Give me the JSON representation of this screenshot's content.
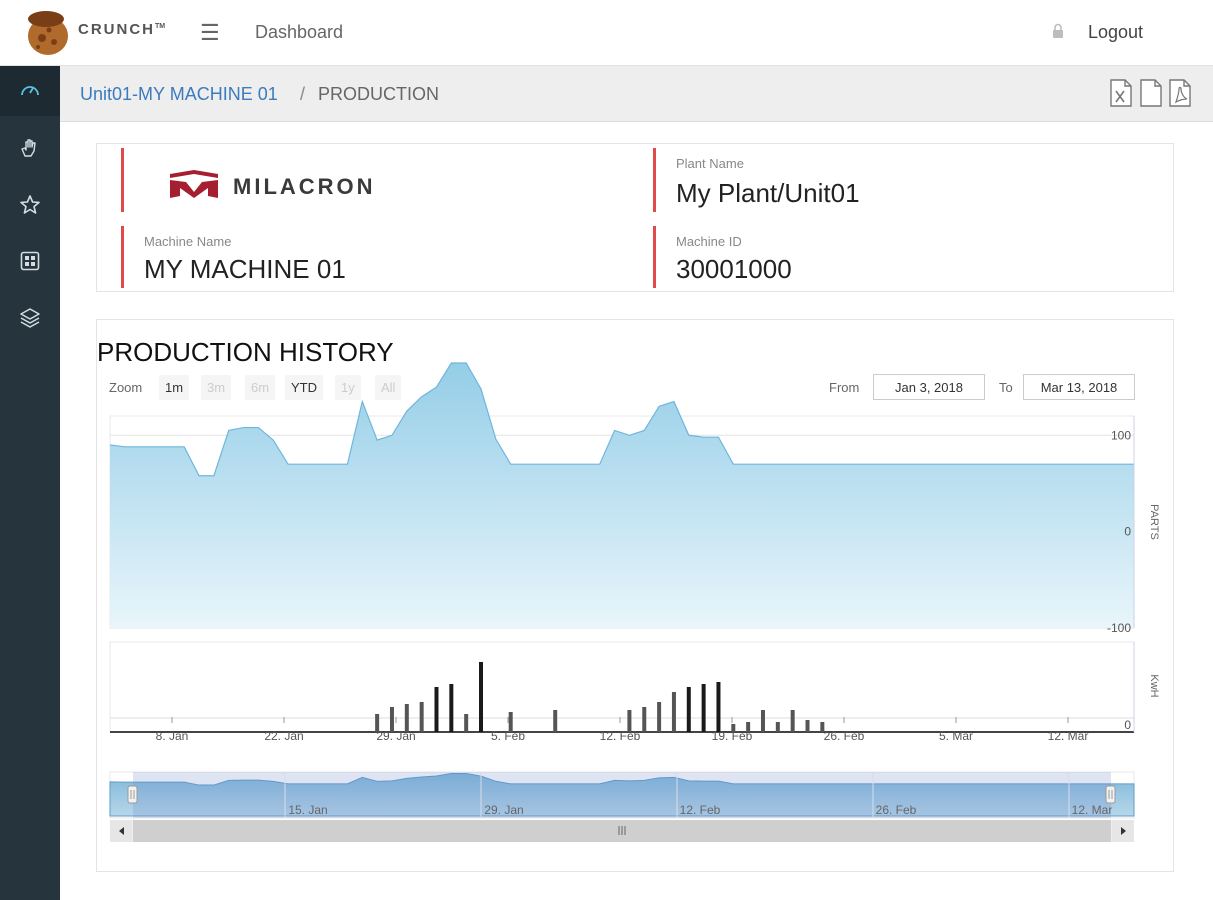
{
  "brand": {
    "name": "CRUNCH",
    "tm": "TM"
  },
  "topnav": {
    "menu_icon": "hamburger-icon",
    "dashboard_label": "Dashboard",
    "logout_label": "Logout",
    "lock_icon": "lock-icon"
  },
  "sidebar": {
    "items": [
      {
        "icon": "gauge-icon",
        "active": true
      },
      {
        "icon": "hand-icon"
      },
      {
        "icon": "star-icon"
      },
      {
        "icon": "grid-icon"
      },
      {
        "icon": "layers-icon"
      }
    ]
  },
  "breadcrumb": {
    "link": "Unit01-MY MACHINE 01",
    "separator": "/",
    "current": "PRODUCTION"
  },
  "export": {
    "buttons": [
      "excel-export-icon",
      "document-export-icon",
      "pdf-export-icon"
    ]
  },
  "colors": {
    "accent": "#e04a4a",
    "link": "#3b7bbf",
    "sidebar": "#25343d",
    "series_fill": "#8fcbe6",
    "logo_red": "#a51f30"
  },
  "machine_info": {
    "logo_text": "MILACRON",
    "plant_name_label": "Plant Name",
    "plant_name": "My Plant/Unit01",
    "machine_name_label": "Machine Name",
    "machine_name": "MY MACHINE 01",
    "machine_id_label": "Machine ID",
    "machine_id": "30001000"
  },
  "production_history": {
    "title": "PRODUCTION HISTORY",
    "zoom_label": "Zoom",
    "zoom_buttons": [
      {
        "label": "1m",
        "enabled": true
      },
      {
        "label": "3m",
        "enabled": false
      },
      {
        "label": "6m",
        "enabled": false
      },
      {
        "label": "YTD",
        "enabled": true
      },
      {
        "label": "1y",
        "enabled": false
      },
      {
        "label": "All",
        "enabled": false
      }
    ],
    "from_label": "From",
    "from_value": "Jan 3, 2018",
    "to_label": "To",
    "to_value": "Mar 13, 2018"
  },
  "chart_data": [
    {
      "type": "area",
      "ylabel": "PARTS",
      "ylim": [
        -100,
        120
      ],
      "yticks": [
        100,
        0,
        -100
      ],
      "grid": true,
      "x_range": [
        "2018-01-03",
        "2018-03-13"
      ],
      "series": [
        {
          "values": [
            [
              0,
              90
            ],
            [
              1,
              88
            ],
            [
              2,
              88
            ],
            [
              3,
              88
            ],
            [
              4,
              88
            ],
            [
              5,
              88
            ],
            [
              6,
              58
            ],
            [
              7,
              58
            ],
            [
              8,
              105
            ],
            [
              9,
              108
            ],
            [
              10,
              108
            ],
            [
              11,
              95
            ],
            [
              12,
              70
            ],
            [
              13,
              70
            ],
            [
              14,
              70
            ],
            [
              15,
              70
            ],
            [
              16,
              70
            ],
            [
              17,
              135
            ],
            [
              18,
              95
            ],
            [
              19,
              100
            ],
            [
              20,
              125
            ],
            [
              21,
              140
            ],
            [
              22,
              150
            ],
            [
              23,
              175
            ],
            [
              24,
              175
            ],
            [
              25,
              148
            ],
            [
              26,
              96
            ],
            [
              27,
              70
            ],
            [
              28,
              70
            ],
            [
              29,
              70
            ],
            [
              30,
              70
            ],
            [
              31,
              70
            ],
            [
              32,
              70
            ],
            [
              33,
              70
            ],
            [
              34,
              105
            ],
            [
              35,
              100
            ],
            [
              36,
              105
            ],
            [
              37,
              130
            ],
            [
              38,
              135
            ],
            [
              39,
              100
            ],
            [
              40,
              98
            ],
            [
              41,
              98
            ],
            [
              42,
              70
            ],
            [
              43,
              70
            ],
            [
              44,
              70
            ],
            [
              45,
              70
            ],
            [
              46,
              70
            ],
            [
              47,
              70
            ],
            [
              48,
              70
            ],
            [
              49,
              70
            ],
            [
              50,
              70
            ],
            [
              51,
              70
            ],
            [
              52,
              70
            ],
            [
              53,
              70
            ],
            [
              54,
              70
            ],
            [
              55,
              70
            ],
            [
              56,
              70
            ],
            [
              57,
              70
            ],
            [
              58,
              70
            ],
            [
              59,
              70
            ],
            [
              60,
              70
            ],
            [
              61,
              70
            ],
            [
              62,
              70
            ],
            [
              63,
              70
            ],
            [
              64,
              70
            ],
            [
              65,
              70
            ],
            [
              66,
              70
            ],
            [
              67,
              70
            ],
            [
              68,
              70
            ],
            [
              69,
              70
            ]
          ]
        }
      ]
    },
    {
      "type": "bar",
      "ylabel": "KwH",
      "yticks": [
        0
      ],
      "xticks": [
        "8. Jan",
        "22. Jan",
        "29. Jan",
        "5. Feb",
        "12. Feb",
        "19. Feb",
        "26. Feb",
        "5. Mar",
        "12. Mar"
      ],
      "series": [
        {
          "values": [
            [
              18,
              18
            ],
            [
              19,
              25
            ],
            [
              20,
              28
            ],
            [
              21,
              30
            ],
            [
              22,
              45
            ],
            [
              23,
              48
            ],
            [
              24,
              18
            ],
            [
              25,
              70
            ],
            [
              27,
              20
            ],
            [
              30,
              22
            ],
            [
              35,
              22
            ],
            [
              36,
              25
            ],
            [
              37,
              30
            ],
            [
              38,
              40
            ],
            [
              39,
              45
            ],
            [
              40,
              48
            ],
            [
              41,
              50
            ],
            [
              42,
              8
            ],
            [
              43,
              10
            ],
            [
              44,
              22
            ],
            [
              45,
              10
            ],
            [
              46,
              22
            ],
            [
              47,
              12
            ],
            [
              48,
              10
            ]
          ]
        }
      ]
    },
    {
      "type": "area",
      "role": "navigator",
      "xticks": [
        "15. Jan",
        "29. Jan",
        "12. Feb",
        "26. Feb",
        "12. Mar"
      ]
    }
  ]
}
